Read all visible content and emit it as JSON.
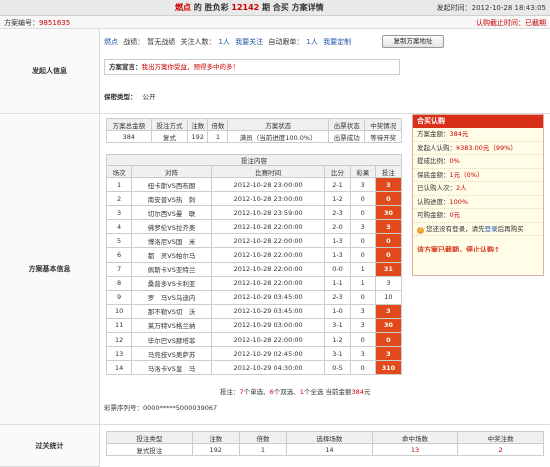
{
  "header": {
    "brand": "燃点",
    "title_prefix": "胜负彩",
    "issue": "12142",
    "title_suffix": "期 合买 方案详情",
    "launch_time": "发起时间：2012-10-28 18:43:05"
  },
  "subheader": {
    "plan_label": "方案编号：",
    "plan_no": "9851635",
    "status": "认购截止时间：已截期"
  },
  "initiator": {
    "section_label": "发起人信息",
    "name": "燃点",
    "record_label": "战绩：",
    "record_value": "暂无战绩",
    "followers_label": "关注人数：",
    "followers_value": "1人",
    "follow_link": "我要关注",
    "auto_label": "自动跟单：",
    "auto_value": "1人",
    "auto_link": "我要定制",
    "copy_button": "复制方案地址",
    "declaration_label": "方案宣言：",
    "declaration_text": "我出方案你受益，预得多中的多！",
    "privacy_label": "保密类型：",
    "privacy_value": "公开"
  },
  "basic": {
    "section_label": "方案基本信息",
    "summary_headers": [
      "方案总金额",
      "投注方式",
      "注数",
      "倍数",
      "方案状态",
      "出票状态",
      "中奖情况"
    ],
    "summary_values": [
      "384",
      "复式",
      "192",
      "1",
      "满员（当前进度100.0%）",
      "出票成功",
      "等待开奖"
    ],
    "content_caption": "投注内容",
    "match_headers": [
      "场次",
      "对阵",
      "比赛时间",
      "比分",
      "彩果",
      "投注"
    ],
    "matches": [
      {
        "no": "1",
        "teams": "纽卡斯VS西布朗",
        "time": "2012-10-28 23:00:00",
        "score": "2-1",
        "result": "3",
        "bet": "3",
        "hit": true
      },
      {
        "no": "2",
        "teams": "南安普VS热　刺",
        "time": "2012-10-28 23:00:00",
        "score": "1-2",
        "result": "0",
        "bet": "0",
        "hit": true
      },
      {
        "no": "3",
        "teams": "切尔西VS曼　联",
        "time": "2012-10-28 23:59:00",
        "score": "2-3",
        "result": "0",
        "bet": "30",
        "hit": true
      },
      {
        "no": "4",
        "teams": "佛罗伦VS拉齐奥",
        "time": "2012-10-28 22:00:00",
        "score": "2-0",
        "result": "3",
        "bet": "3",
        "hit": true
      },
      {
        "no": "5",
        "teams": "博洛尼VS国　米",
        "time": "2012-10-28 22:00:00",
        "score": "1-3",
        "result": "0",
        "bet": "0",
        "hit": true
      },
      {
        "no": "6",
        "teams": "都　灵VS帕尔马",
        "time": "2012-10-28 22:00:00",
        "score": "1-3",
        "result": "0",
        "bet": "0",
        "hit": true
      },
      {
        "no": "7",
        "teams": "佩斯卡VS亚特兰",
        "time": "2012-10-28 22:00:00",
        "score": "0-0",
        "result": "1",
        "bet": "31",
        "hit": true
      },
      {
        "no": "8",
        "teams": "桑普多VS卡利亚",
        "time": "2012-10-28 22:00:00",
        "score": "1-1",
        "result": "1",
        "bet": "3",
        "hit": false
      },
      {
        "no": "9",
        "teams": "罗　马VS乌迪内",
        "time": "2012-10-29 03:45:00",
        "score": "2-3",
        "result": "0",
        "bet": "10",
        "hit": false
      },
      {
        "no": "10",
        "teams": "那不勒VS切　沃",
        "time": "2012-10-29 03:45:00",
        "score": "1-0",
        "result": "3",
        "bet": "3",
        "hit": true
      },
      {
        "no": "11",
        "teams": "莱万特VS格兰纳",
        "time": "2012-10-29 03:00:00",
        "score": "3-1",
        "result": "3",
        "bet": "30",
        "hit": true
      },
      {
        "no": "12",
        "teams": "毕尔巴VS赫塔菲",
        "time": "2012-10-28 22:00:00",
        "score": "1-2",
        "result": "0",
        "bet": "0",
        "hit": true
      },
      {
        "no": "13",
        "teams": "马竞技VS奥萨苏",
        "time": "2012-10-29 02:45:00",
        "score": "3-1",
        "result": "3",
        "bet": "3",
        "hit": true
      },
      {
        "no": "14",
        "teams": "马洛卡VS皇　马",
        "time": "2012-10-29 04:30:00",
        "score": "0-5",
        "result": "0",
        "bet": "310",
        "hit": true
      }
    ],
    "summary_line_prefix": "投注：",
    "summary_single": "7",
    "summary_single_label": "个单选、",
    "summary_double": "6",
    "summary_double_label": "个双选、",
    "summary_triple": "1",
    "summary_triple_label": "个全选 当前金额",
    "summary_amount": "384",
    "summary_unit": "元",
    "ticket_label": "彩票序列号：",
    "ticket_value": "0000*****5000039067"
  },
  "buy_panel": {
    "title": "合买认购",
    "lines": [
      {
        "label": "方案金额：",
        "value": "384",
        "suffix": "元"
      },
      {
        "label": "发起人认购：",
        "value": "¥383.00元（99%）",
        "suffix": ""
      },
      {
        "label": "提成比例：",
        "value": "0%",
        "suffix": ""
      },
      {
        "label": "保底金额：",
        "value": "1元（0%）",
        "suffix": ""
      },
      {
        "label": "已认购人次：",
        "value": "2人",
        "suffix": ""
      },
      {
        "label": "认购进度：",
        "value": "100%",
        "suffix": ""
      },
      {
        "label": "可购金额：",
        "value": "0元",
        "suffix": ""
      }
    ],
    "login_prefix": "您还没有登录，请先",
    "login_link": "登录",
    "login_suffix": "后再购买",
    "notice": "该方案已截期，停止认购↑"
  },
  "pass": {
    "section_label": "过关统计",
    "headers": [
      "投注类型",
      "注数",
      "倍数",
      "选择场数",
      "命中场数",
      "中奖注数"
    ],
    "values": [
      "复式投注",
      "192",
      "1",
      "14",
      "13",
      "2"
    ]
  },
  "colors": {
    "accent": "#e24a1b",
    "panel_head": "#d8311a",
    "brand_red": "#cc0000"
  }
}
